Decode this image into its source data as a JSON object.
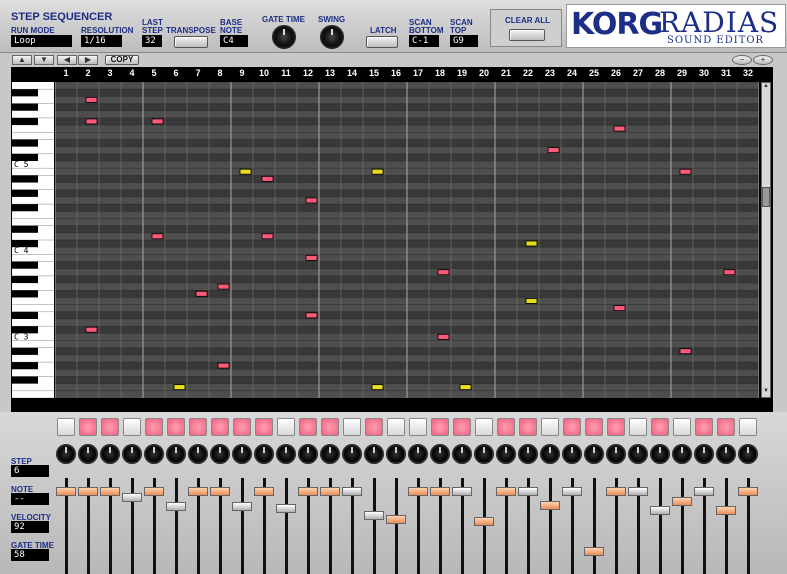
{
  "header": {
    "title": "STEP SEQUENCER",
    "run_mode_label": "RUN MODE",
    "run_mode_value": "Loop",
    "resolution_label": "RESOLUTION",
    "resolution_value": "1/16",
    "last_step_label_1": "LAST",
    "last_step_label_2": "STEP",
    "last_step_value": "32",
    "transpose_label": "TRANSPOSE",
    "base_note_label_1": "BASE",
    "base_note_label_2": "NOTE",
    "base_note_value": "C4",
    "gate_time_label": "GATE TIME",
    "swing_label": "SWING",
    "latch_label": "LATCH",
    "scan_bottom_label_1": "SCAN",
    "scan_bottom_label_2": "BOTTOM",
    "scan_bottom_value": "C-1",
    "scan_top_label_1": "SCAN",
    "scan_top_label_2": "TOP",
    "scan_top_value": "G9",
    "clear_all_label": "CLEAR ALL"
  },
  "logo": {
    "korg": "KORG",
    "radias": "RADIAS",
    "sub": "SOUND EDITOR"
  },
  "toolbar": {
    "copy_label": "COPY"
  },
  "piano": {
    "labels": [
      "C 5",
      "C 4",
      "C 3"
    ]
  },
  "steps": [
    "1",
    "2",
    "3",
    "4",
    "5",
    "6",
    "7",
    "8",
    "9",
    "10",
    "11",
    "12",
    "13",
    "14",
    "15",
    "16",
    "17",
    "18",
    "19",
    "20",
    "21",
    "22",
    "23",
    "24",
    "25",
    "26",
    "27",
    "28",
    "29",
    "30",
    "31",
    "32"
  ],
  "notes": [
    {
      "step": 2,
      "row": 2,
      "color": "pink"
    },
    {
      "step": 2,
      "row": 5,
      "color": "pink"
    },
    {
      "step": 5,
      "row": 5,
      "color": "pink"
    },
    {
      "step": 26,
      "row": 6,
      "color": "pink"
    },
    {
      "step": 23,
      "row": 9,
      "color": "pink"
    },
    {
      "step": 9,
      "row": 12,
      "color": "yel"
    },
    {
      "step": 15,
      "row": 12,
      "color": "yel"
    },
    {
      "step": 29,
      "row": 12,
      "color": "pink"
    },
    {
      "step": 10,
      "row": 13,
      "color": "pink"
    },
    {
      "step": 12,
      "row": 16,
      "color": "pink"
    },
    {
      "step": 5,
      "row": 21,
      "color": "pink"
    },
    {
      "step": 10,
      "row": 21,
      "color": "pink"
    },
    {
      "step": 22,
      "row": 22,
      "color": "yel"
    },
    {
      "step": 12,
      "row": 24,
      "color": "pink"
    },
    {
      "step": 18,
      "row": 26,
      "color": "pink"
    },
    {
      "step": 31,
      "row": 26,
      "color": "pink"
    },
    {
      "step": 8,
      "row": 28,
      "color": "pink"
    },
    {
      "step": 7,
      "row": 29,
      "color": "pink"
    },
    {
      "step": 22,
      "row": 30,
      "color": "yel"
    },
    {
      "step": 26,
      "row": 31,
      "color": "pink"
    },
    {
      "step": 12,
      "row": 32,
      "color": "pink"
    },
    {
      "step": 2,
      "row": 34,
      "color": "pink"
    },
    {
      "step": 18,
      "row": 35,
      "color": "pink"
    },
    {
      "step": 29,
      "row": 37,
      "color": "pink"
    },
    {
      "step": 8,
      "row": 39,
      "color": "pink"
    },
    {
      "step": 6,
      "row": 42,
      "color": "yel"
    },
    {
      "step": 15,
      "row": 42,
      "color": "yel"
    },
    {
      "step": 19,
      "row": 42,
      "color": "yel"
    }
  ],
  "step_buttons_on": [
    2,
    3,
    5,
    6,
    7,
    8,
    9,
    10,
    12,
    13,
    15,
    18,
    19,
    21,
    22,
    24,
    25,
    26,
    28,
    30,
    31
  ],
  "fader_levels": [
    0.9,
    0.9,
    0.9,
    0.83,
    0.9,
    0.72,
    0.9,
    0.9,
    0.72,
    0.9,
    0.7,
    0.9,
    0.9,
    0.9,
    0.62,
    0.57,
    0.9,
    0.9,
    0.9,
    0.55,
    0.9,
    0.9,
    0.73,
    0.9,
    0.2,
    0.9,
    0.9,
    0.68,
    0.78,
    0.9,
    0.68,
    0.9
  ],
  "fader_colors_pink": [
    1,
    2,
    3,
    5,
    7,
    8,
    10,
    12,
    13,
    16,
    17,
    18,
    20,
    21,
    23,
    25,
    26,
    29,
    31,
    32
  ],
  "side": {
    "step_label": "STEP",
    "step_value": "6",
    "note_label": "NOTE",
    "note_value": "--",
    "velocity_label": "VELOCITY",
    "velocity_value": "92",
    "gate_time_label": "GATE TIME",
    "gate_time_value": "58"
  },
  "colors": {
    "brand": "#1c2e86",
    "note_pink": "#ff5a7a",
    "note_yellow": "#e6dc20",
    "step_on": "#f06080"
  },
  "icons": [
    "up-icon",
    "down-icon",
    "left-icon",
    "right-icon",
    "zoom-out-icon",
    "zoom-in-icon"
  ]
}
